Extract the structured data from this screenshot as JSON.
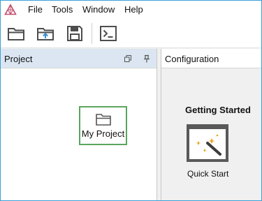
{
  "menubar": {
    "logo": "app-logo-icon",
    "items": [
      {
        "label": "File"
      },
      {
        "label": "Tools"
      },
      {
        "label": "Window"
      },
      {
        "label": "Help"
      }
    ]
  },
  "toolbar": {
    "buttons": [
      {
        "icon": "open-folder-icon"
      },
      {
        "icon": "upload-folder-icon"
      },
      {
        "icon": "save-icon"
      },
      {
        "icon": "terminal-icon"
      }
    ],
    "accent_color": "#3a8fd0"
  },
  "project_panel": {
    "title": "Project",
    "header_color": "#dbe6f2",
    "header_icons": [
      "restore-icon",
      "pin-icon"
    ],
    "node": {
      "label": "My Project",
      "icon": "folder-icon",
      "border_color": "#5aa55e"
    }
  },
  "config_panel": {
    "title": "Configuration",
    "getting_started": {
      "heading": "Getting Started",
      "tile_icon": "magic-wand-icon",
      "tile_label": "Quick Start"
    }
  }
}
